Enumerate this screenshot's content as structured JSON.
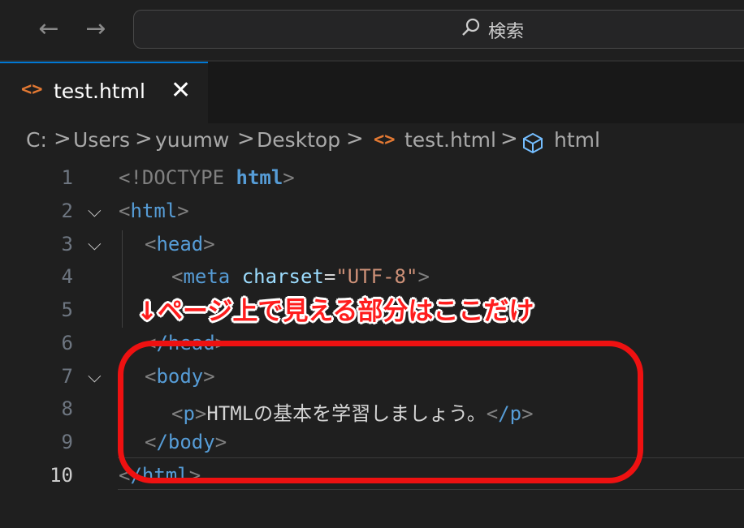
{
  "titlebar": {
    "back_icon": "arrow-left-icon",
    "forward_icon": "arrow-right-icon",
    "search_placeholder": "検索",
    "search_icon": "search-icon"
  },
  "tab": {
    "label": "test.html",
    "close": "✕",
    "icon": "html-file-icon"
  },
  "breadcrumb": {
    "items": [
      "C:",
      "Users",
      "yuumw",
      "Desktop",
      "test.html",
      "html"
    ],
    "separator": ">"
  },
  "editor": {
    "line_numbers": [
      "1",
      "2",
      "3",
      "4",
      "5",
      "6",
      "7",
      "8",
      "9",
      "10"
    ],
    "current_line": "10",
    "code": {
      "l1_open": "<!DOCTYPE ",
      "l1_kw": "html",
      "l1_close": ">",
      "l2_tag": "html",
      "l3_tag": "head",
      "l4_tag": "meta",
      "l4_attr": "charset",
      "l4_eq": "=",
      "l4_val": "\"UTF-8\"",
      "l6_tag": "/head",
      "l7_tag": "body",
      "l8_tag_open": "p",
      "l8_text": "HTMLの基本を学習しましょう。",
      "l8_tag_close": "/p",
      "l9_tag": "/body",
      "l10_tag": "/html"
    }
  },
  "annotation": {
    "text": "↓ページ上で見える部分はここだけ",
    "color": "#ff1d1d"
  },
  "colors": {
    "tag": "#569cd6",
    "attr": "#9cdcfe",
    "string": "#ce9178",
    "bracket": "#808080",
    "highlight": "#ee1111"
  }
}
